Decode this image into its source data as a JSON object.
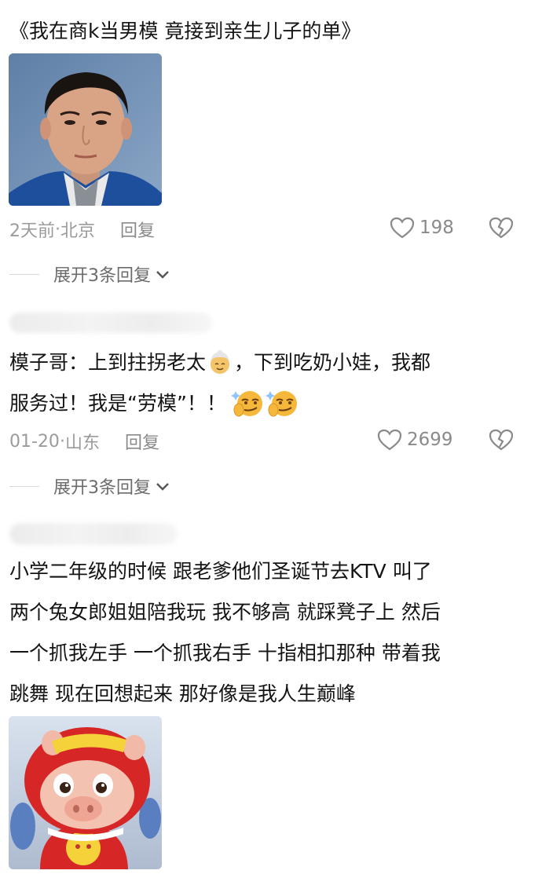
{
  "top_line": {
    "title": "《我在商k当男模 竟接到亲生儿子的单》"
  },
  "comments": [
    {
      "time": "2天前",
      "location": "北京",
      "reply_label": "回复",
      "likes": "198",
      "expand_label": "展开3条回复"
    },
    {
      "line1_prefix": "模子哥：上到拄拐老太",
      "line1_suffix": "，下到吃奶小娃，我都",
      "line2": "服务过！我是“劳模”！！",
      "time": "01-20",
      "location": "山东",
      "reply_label": "回复",
      "likes": "2699",
      "expand_label": "展开3条回复"
    },
    {
      "lines": [
        "小学二年级的时候 跟老爹他们圣诞节去KTV 叫了",
        "两个兔女郎姐姐陪我玩 我不够高 就踩凳子上 然后",
        "一个抓我左手 一个抓我右手 十指相扣那种 带着我",
        "跳舞 现在回想起来 那好像是我人生巅峰"
      ]
    }
  ],
  "separator": " · ",
  "icons": {
    "like": "heart-outline-icon",
    "dislike": "broken-heart-icon",
    "chevron": "chevron-down-icon",
    "old_lady": "old-woman-emoji-icon",
    "smirk": "smirk-emoji-icon"
  },
  "colors": {
    "meta_text": "#9b9b9b",
    "body_text": "#141414",
    "divider": "#d9d9d9"
  }
}
